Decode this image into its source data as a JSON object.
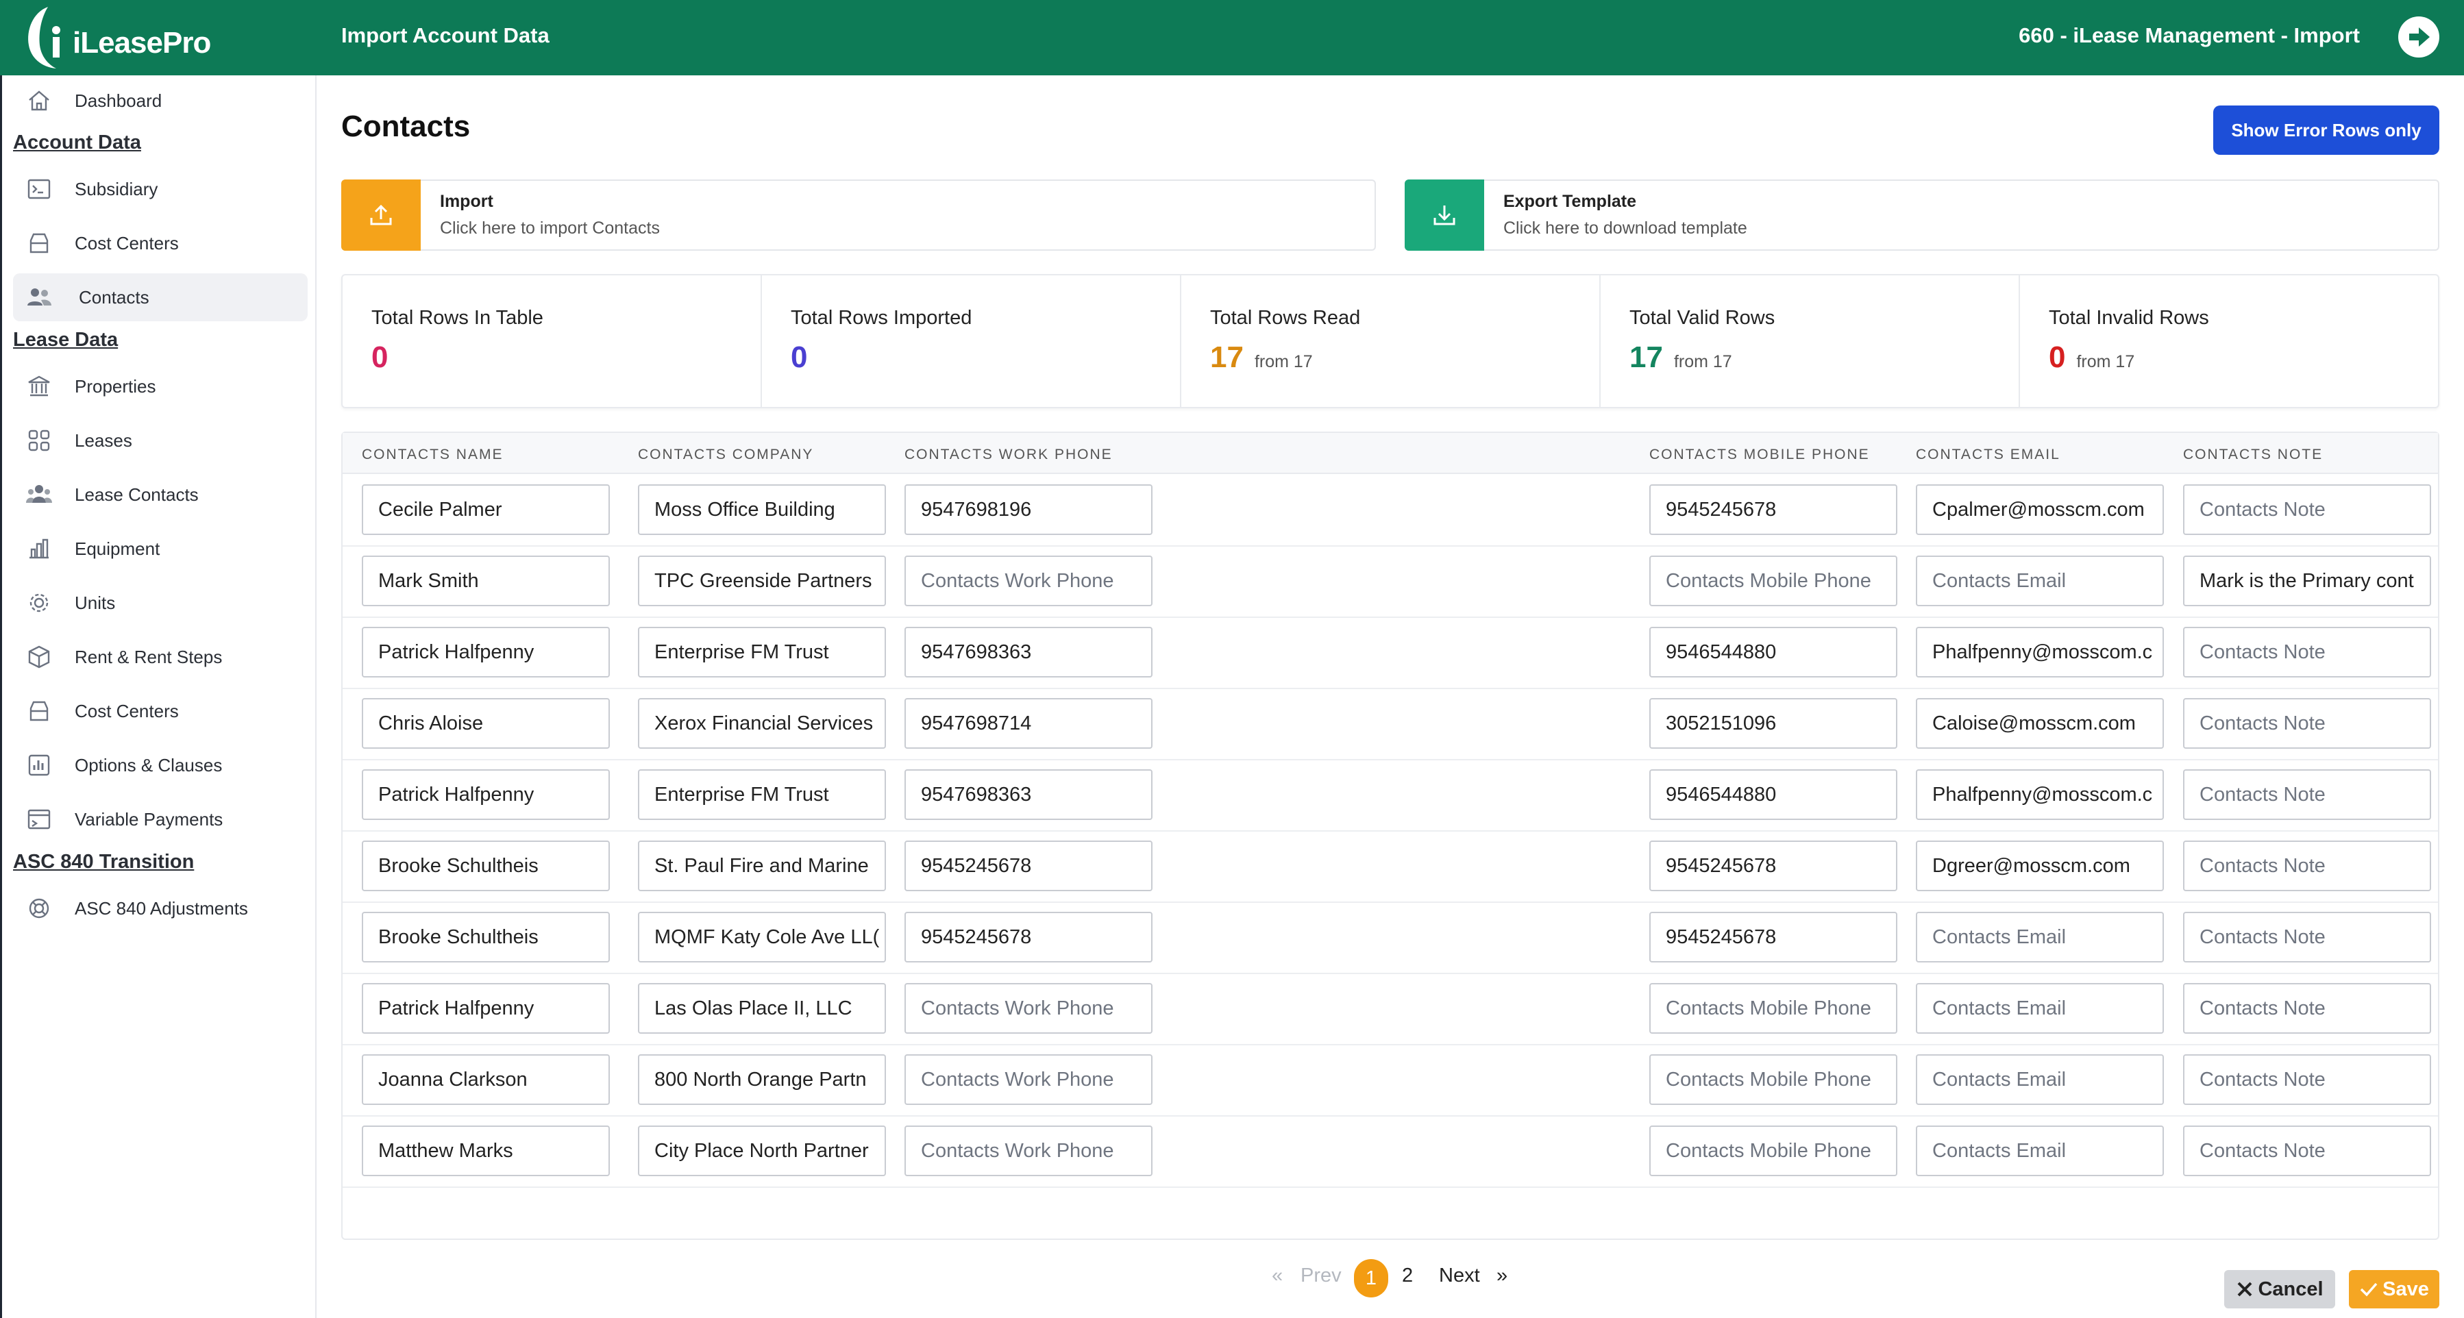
{
  "topbar": {
    "logo_text": "iLeasePro",
    "page_name": "Import Account Data",
    "context": "660 - iLease Management - Import",
    "brand_color": "#0d7a56"
  },
  "sidebar": {
    "dashboard": "Dashboard",
    "sections": {
      "account_data": "Account Data",
      "lease_data": "Lease Data",
      "asc840": "ASC 840 Transition"
    },
    "account_items": [
      {
        "label": "Subsidiary",
        "icon": "terminal-icon"
      },
      {
        "label": "Cost Centers",
        "icon": "drawer-icon"
      },
      {
        "label": "Contacts",
        "icon": "users-icon",
        "active": true
      }
    ],
    "lease_items": [
      {
        "label": "Properties",
        "icon": "bank-icon"
      },
      {
        "label": "Leases",
        "icon": "grid-icon"
      },
      {
        "label": "Lease Contacts",
        "icon": "people-icon"
      },
      {
        "label": "Equipment",
        "icon": "bar-chart-icon"
      },
      {
        "label": "Units",
        "icon": "gear-icon"
      },
      {
        "label": "Rent & Rent Steps",
        "icon": "box-icon"
      },
      {
        "label": "Cost Centers",
        "icon": "drawer-icon"
      },
      {
        "label": "Options & Clauses",
        "icon": "chart-square-icon"
      },
      {
        "label": "Variable Payments",
        "icon": "window-icon"
      }
    ],
    "asc_items": [
      {
        "label": "ASC 840 Adjustments",
        "icon": "lifebuoy-icon"
      }
    ]
  },
  "main": {
    "title": "Contacts",
    "error_button": "Show Error Rows only",
    "import": {
      "title": "Import",
      "subtitle": "Click here to import Contacts",
      "color": "#f5a31a"
    },
    "export": {
      "title": "Export Template",
      "subtitle": "Click here to download template",
      "color": "#1aa87a"
    }
  },
  "stats": [
    {
      "label": "Total Rows In Table",
      "value": "0",
      "from": "",
      "color": "#d6245f"
    },
    {
      "label": "Total Rows Imported",
      "value": "0",
      "from": "",
      "color": "#4a3fd1"
    },
    {
      "label": "Total Rows Read",
      "value": "17",
      "from": "from 17",
      "color": "#d98a10"
    },
    {
      "label": "Total Valid Rows",
      "value": "17",
      "from": "from 17",
      "color": "#14855f"
    },
    {
      "label": "Total Invalid Rows",
      "value": "0",
      "from": "from 17",
      "color": "#d62020"
    }
  ],
  "table": {
    "columns": [
      "CONTACTS NAME",
      "CONTACTS COMPANY",
      "CONTACTS WORK PHONE",
      "CONTACTS MOBILE PHONE",
      "CONTACTS EMAIL",
      "CONTACTS NOTE"
    ],
    "placeholders": {
      "work_phone": "Contacts Work Phone",
      "mobile_phone": "Contacts Mobile Phone",
      "email": "Contacts Email",
      "note": "Contacts Note"
    },
    "rows": [
      {
        "name": "Cecile Palmer",
        "company": "Moss Office Building",
        "work_phone": "9547698196",
        "mobile_phone": "9545245678",
        "email": "Cpalmer@mosscm.com",
        "note": ""
      },
      {
        "name": "Mark Smith",
        "company": "TPC Greenside Partners",
        "work_phone": "",
        "mobile_phone": "",
        "email": "",
        "note": "Mark is the Primary cont"
      },
      {
        "name": "Patrick Halfpenny",
        "company": "Enterprise FM Trust",
        "work_phone": "9547698363",
        "mobile_phone": "9546544880",
        "email": "Phalfpenny@mosscom.c",
        "note": ""
      },
      {
        "name": "Chris Aloise",
        "company": "Xerox Financial Services",
        "work_phone": "9547698714",
        "mobile_phone": "3052151096",
        "email": "Caloise@mosscm.com",
        "note": ""
      },
      {
        "name": "Patrick Halfpenny",
        "company": "Enterprise FM Trust",
        "work_phone": "9547698363",
        "mobile_phone": "9546544880",
        "email": "Phalfpenny@mosscom.c",
        "note": ""
      },
      {
        "name": "Brooke Schultheis",
        "company": "St. Paul Fire and Marine",
        "work_phone": "9545245678",
        "mobile_phone": "9545245678",
        "email": "Dgreer@mosscm.com",
        "note": ""
      },
      {
        "name": "Brooke Schultheis",
        "company": "MQMF Katy Cole Ave LL(",
        "work_phone": "9545245678",
        "mobile_phone": "9545245678",
        "email": "",
        "note": ""
      },
      {
        "name": "Patrick Halfpenny",
        "company": "Las Olas Place II, LLC",
        "work_phone": "",
        "mobile_phone": "",
        "email": "",
        "note": ""
      },
      {
        "name": "Joanna Clarkson",
        "company": "800 North Orange Partn",
        "work_phone": "",
        "mobile_phone": "",
        "email": "",
        "note": ""
      },
      {
        "name": "Matthew Marks",
        "company": "City Place North Partner",
        "work_phone": "",
        "mobile_phone": "",
        "email": "",
        "note": ""
      }
    ]
  },
  "pagination": {
    "first": "«",
    "prev": "Prev",
    "pages": [
      "1",
      "2"
    ],
    "current": "1",
    "next": "Next",
    "last": "»"
  },
  "footer": {
    "cancel": "Cancel",
    "save": "Save"
  }
}
